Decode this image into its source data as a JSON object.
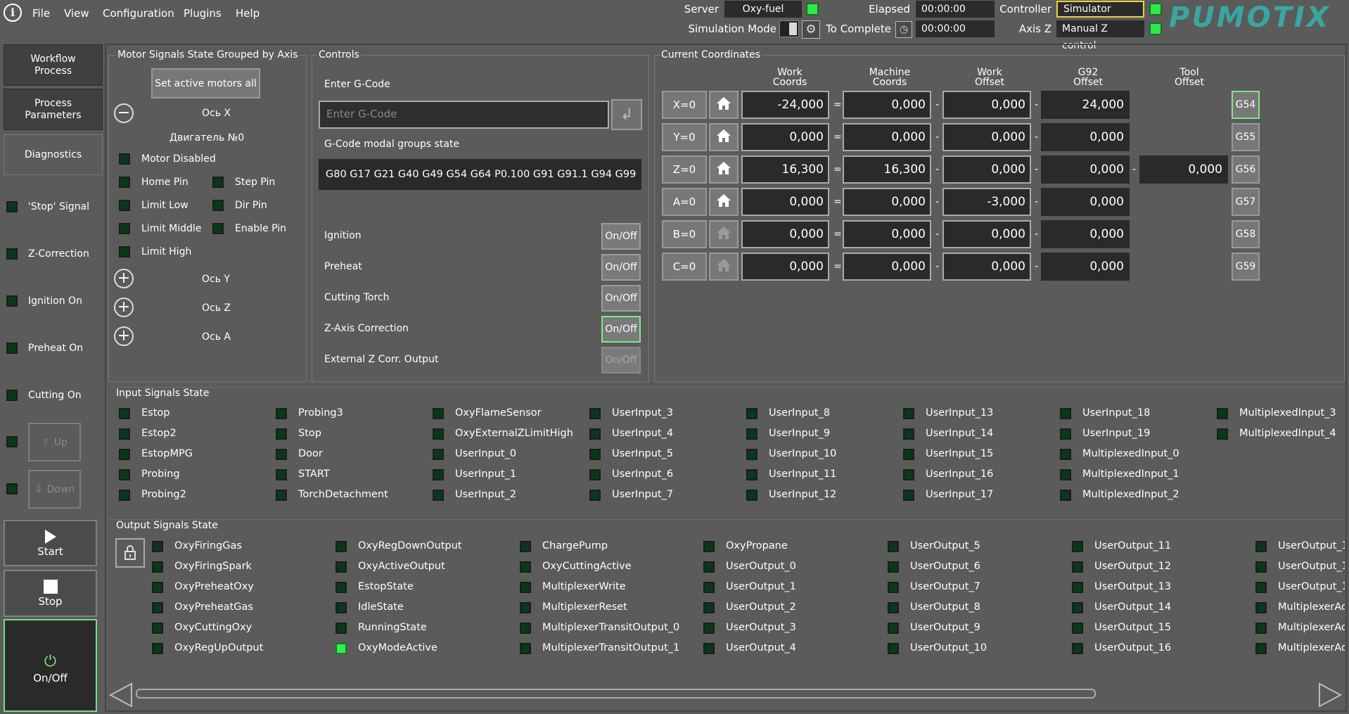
{
  "menu": [
    "File",
    "View",
    "Configuration",
    "Plugins",
    "Help"
  ],
  "top": {
    "server_label": "Server",
    "server_value": "Oxy-fuel",
    "sim_mode_label": "Simulation Mode",
    "elapsed_label": "Elapsed",
    "elapsed_value": "00:00:00",
    "to_complete_label": "To Complete",
    "to_complete_value": "00:00:00",
    "controller_label": "Controller",
    "controller_value": "Simulator",
    "axisz_label": "Axis Z",
    "axisz_value": "Manual Z control",
    "logo": "PUMOTIX",
    "accent_color": "#39a6a0"
  },
  "nav": {
    "workflow": "Workflow\nProcess",
    "process_params": "Process\nParameters",
    "diagnostics": "Diagnostics"
  },
  "left_signals": [
    "'Stop' Signal",
    "Z-Correction",
    "Ignition On",
    "Preheat On",
    "Cutting On"
  ],
  "left_buttons": {
    "up": "Up",
    "down": "Down",
    "start": "Start",
    "stop": "Stop",
    "onoff": "On/Off"
  },
  "motor": {
    "title": "Motor Signals State Grouped by Axis",
    "set_active": "Set active motors all",
    "axis_x": "Ось X",
    "motor0": "Двигатель №0",
    "signals_left": [
      "Motor Disabled",
      "Home Pin",
      "Limit Low",
      "Limit Middle",
      "Limit High"
    ],
    "signals_right": [
      "Step Pin",
      "Dir Pin",
      "Enable Pin"
    ],
    "axis_y": "Ось Y",
    "axis_z": "Ось Z",
    "axis_a": "Ось A"
  },
  "controls": {
    "title": "Controls",
    "enter_gcode_label": "Enter G-Code",
    "gcode_placeholder": "Enter G-Code",
    "modal_label": "G-Code modal groups state",
    "modal_value": "G80 G17 G21 G40 G49 G54 G64 P0.100 G91 G91.1 G94 G99",
    "rows": [
      "Ignition",
      "Preheat",
      "Cutting Torch",
      "Z-Axis Correction",
      "External Z Corr. Output"
    ],
    "onoff": "On/Off"
  },
  "coords": {
    "title": "Current Coordinates",
    "headers": {
      "work": "Work\nCoords",
      "machine": "Machine\nCoords",
      "work_offset": "Work\nOffset",
      "g92": "G92\nOffset",
      "tool": "Tool\nOffset"
    },
    "rows": [
      {
        "axis": "X=0",
        "work": "-24,000",
        "machine": "0,000",
        "woff": "0,000",
        "g92": "24,000",
        "tool": "",
        "g": "G54"
      },
      {
        "axis": "Y=0",
        "work": "0,000",
        "machine": "0,000",
        "woff": "0,000",
        "g92": "0,000",
        "tool": "",
        "g": "G55"
      },
      {
        "axis": "Z=0",
        "work": "16,300",
        "machine": "16,300",
        "woff": "0,000",
        "g92": "0,000",
        "tool": "0,000",
        "g": "G56"
      },
      {
        "axis": "A=0",
        "work": "0,000",
        "machine": "0,000",
        "woff": "-3,000",
        "g92": "0,000",
        "tool": "",
        "g": "G57"
      },
      {
        "axis": "B=0",
        "work": "0,000",
        "machine": "0,000",
        "woff": "0,000",
        "g92": "0,000",
        "tool": "",
        "g": "G58"
      },
      {
        "axis": "C=0",
        "work": "0,000",
        "machine": "0,000",
        "woff": "0,000",
        "g92": "0,000",
        "tool": "",
        "g": "G59"
      }
    ]
  },
  "inputs": {
    "title": "Input Signals State",
    "columns": [
      [
        "Estop",
        "Estop2",
        "EstopMPG",
        "Probing",
        "Probing2"
      ],
      [
        "Probing3",
        "Stop",
        "Door",
        "START",
        "TorchDetachment"
      ],
      [
        "OxyFlameSensor",
        "OxyExternalZLimitHigh",
        "UserInput_0",
        "UserInput_1",
        "UserInput_2"
      ],
      [
        "UserInput_3",
        "UserInput_4",
        "UserInput_5",
        "UserInput_6",
        "UserInput_7"
      ],
      [
        "UserInput_8",
        "UserInput_9",
        "UserInput_10",
        "UserInput_11",
        "UserInput_12"
      ],
      [
        "UserInput_13",
        "UserInput_14",
        "UserInput_15",
        "UserInput_16",
        "UserInput_17"
      ],
      [
        "UserInput_18",
        "UserInput_19",
        "MultiplexedInput_0",
        "MultiplexedInput_1",
        "MultiplexedInput_2"
      ],
      [
        "MultiplexedInput_3",
        "MultiplexedInput_4"
      ]
    ]
  },
  "outputs": {
    "title": "Output Signals State",
    "columns": [
      [
        "OxyFiringGas",
        "OxyFiringSpark",
        "OxyPreheatOxy",
        "OxyPreheatGas",
        "OxyCuttingOxy",
        "OxyRegUpOutput"
      ],
      [
        "OxyRegDownOutput",
        "OxyActiveOutput",
        "EstopState",
        "IdleState",
        "RunningState",
        "OxyModeActive"
      ],
      [
        "ChargePump",
        "OxyCuttingActive",
        "MultiplexerWrite",
        "MultiplexerReset",
        "MultiplexerTransitOutput_0",
        "MultiplexerTransitOutput_1"
      ],
      [
        "OxyPropane",
        "UserOutput_0",
        "UserOutput_1",
        "UserOutput_2",
        "UserOutput_3",
        "UserOutput_4"
      ],
      [
        "UserOutput_5",
        "UserOutput_6",
        "UserOutput_7",
        "UserOutput_8",
        "UserOutput_9",
        "UserOutput_10"
      ],
      [
        "UserOutput_11",
        "UserOutput_12",
        "UserOutput_13",
        "UserOutput_14",
        "UserOutput_15",
        "UserOutput_16"
      ],
      [
        "UserOutput_1",
        "UserOutput_1",
        "UserOutput_1",
        "MultiplexerAd",
        "MultiplexerAd",
        "MultiplexerAd"
      ]
    ],
    "active": "OxyModeActive"
  }
}
